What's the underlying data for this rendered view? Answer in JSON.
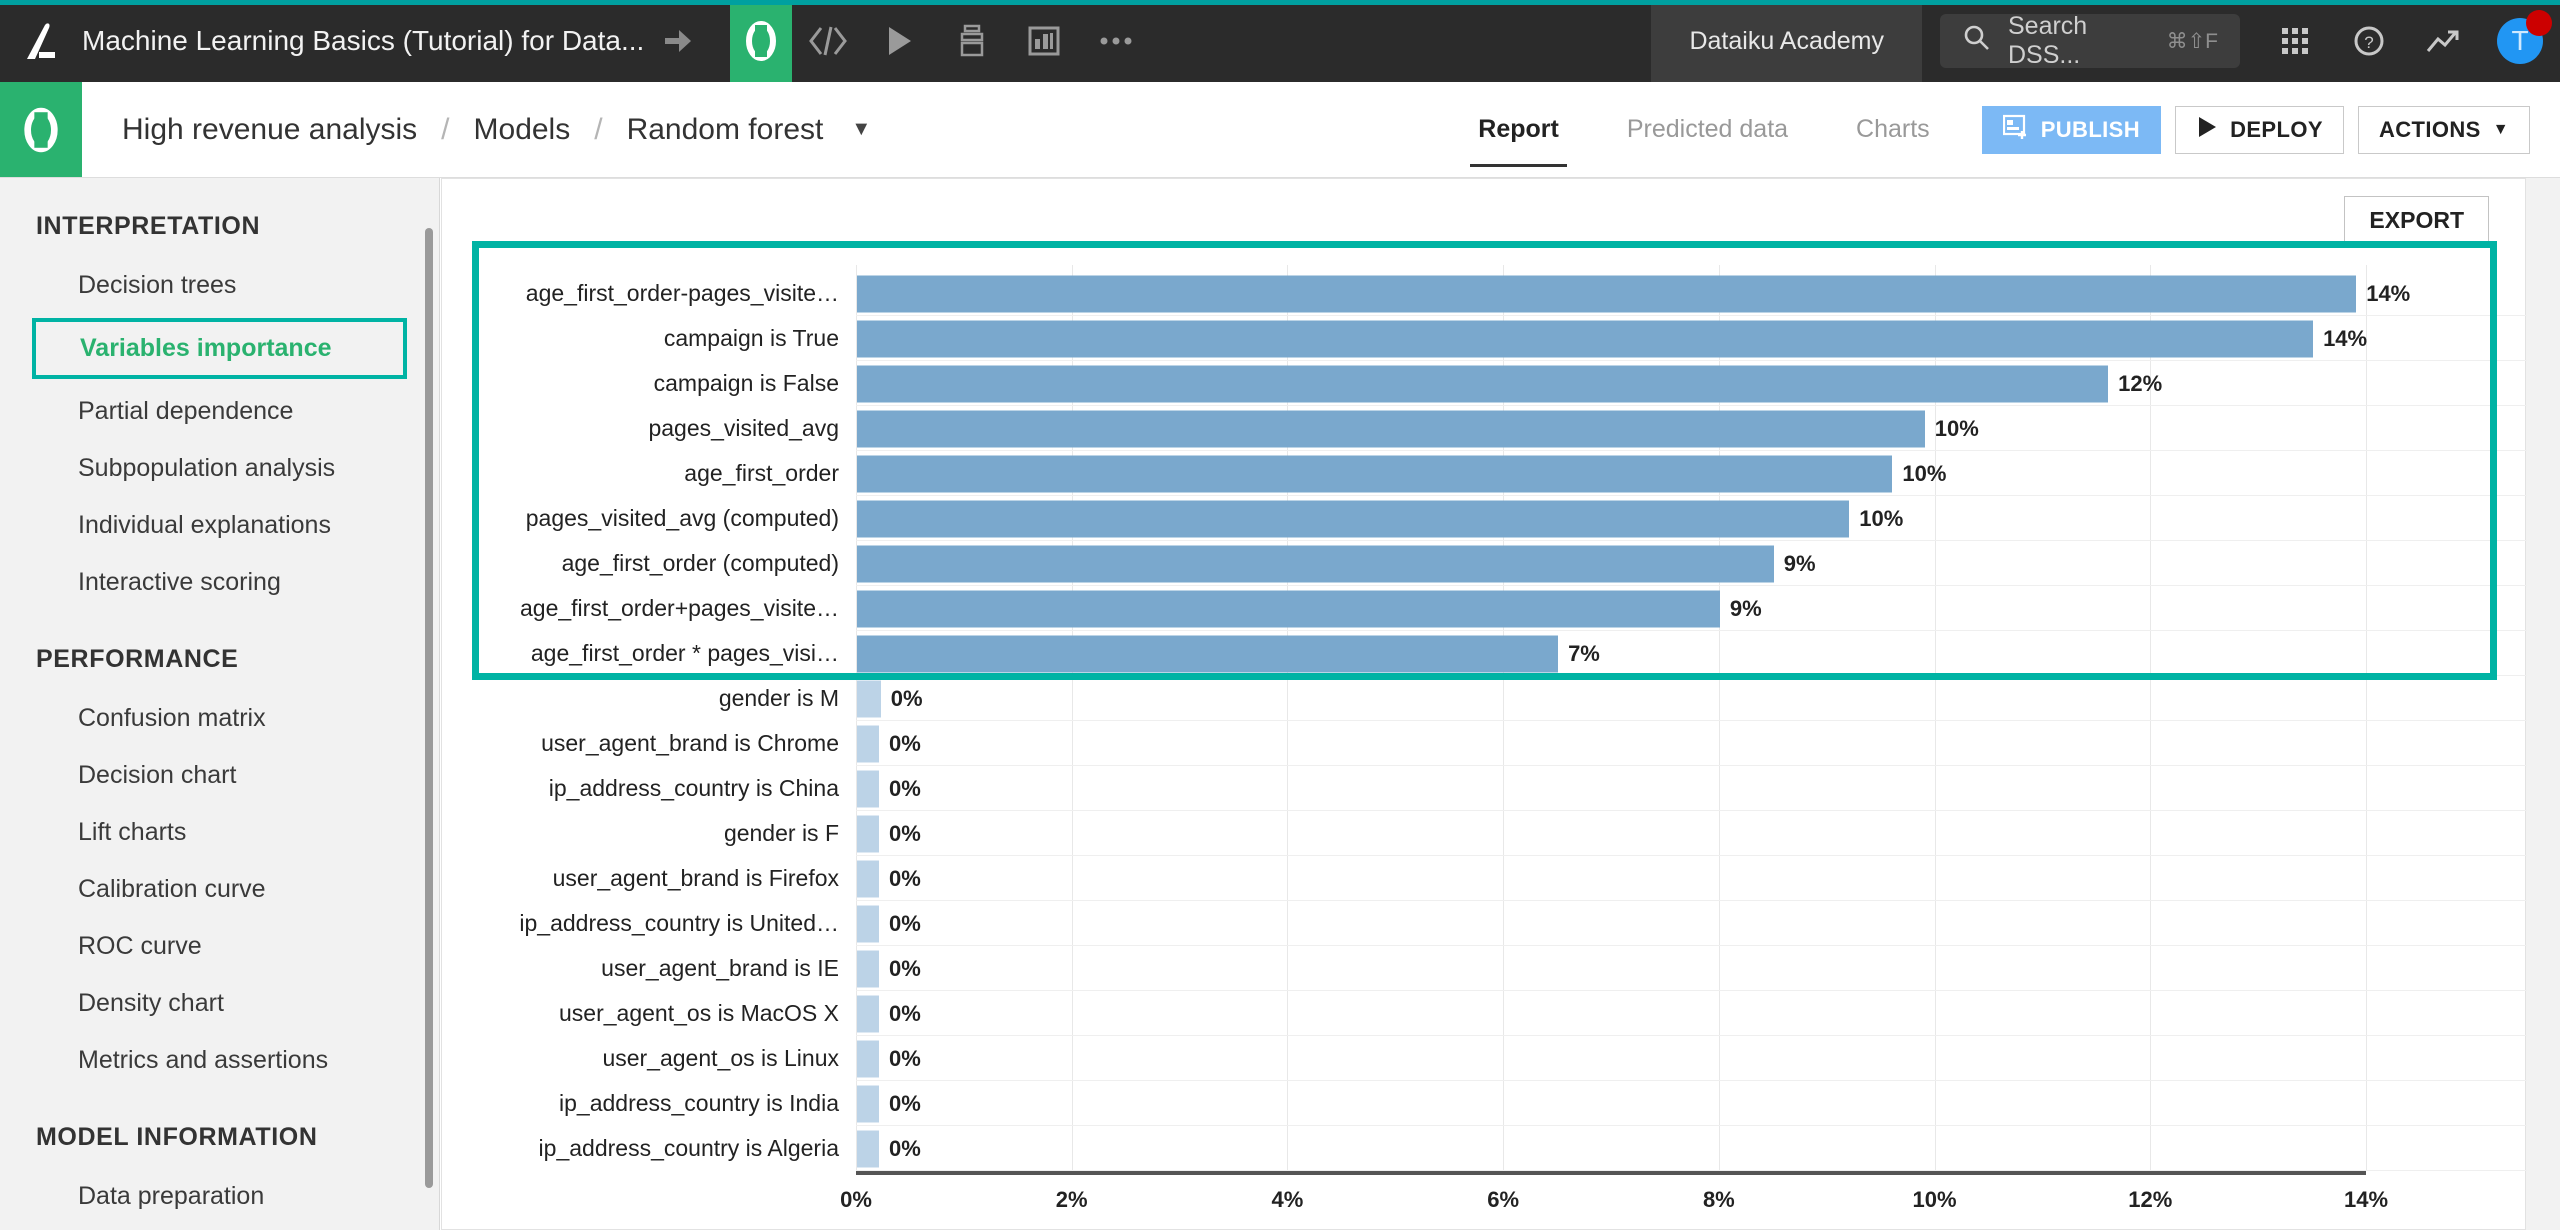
{
  "topbar": {
    "project_title": "Machine Learning Basics (Tutorial) for Data...",
    "logo_icon": "dataiku-flame-icon",
    "flow_icon": "flow-branch-icon",
    "lab_icon": "dataiku-lab-icon",
    "code_icon": "code-brackets-icon",
    "run_icon": "play-triangle-icon",
    "jobs_icon": "jobs-stack-icon",
    "dashboard_icon": "dashboard-panel-icon",
    "more_icon": "ellipsis-icon",
    "academy_label": "Dataiku Academy",
    "search_placeholder": "Search DSS...",
    "search_icon": "search-icon",
    "search_shortcut": "⌘⇧F",
    "apps_icon": "apps-grid-icon",
    "help_icon": "help-circle-icon",
    "trend_icon": "trend-arrow-icon",
    "avatar_initial": "T",
    "avatar_name": "avatar",
    "notification_badge": ""
  },
  "subnav": {
    "logo_icon": "dataiku-project-icon",
    "breadcrumb": [
      "High revenue analysis",
      "Models",
      "Random forest"
    ],
    "breadcrumb_separator": "/",
    "breadcrumb_caret": "▼",
    "tabs": [
      {
        "label": "Report",
        "active": true
      },
      {
        "label": "Predicted data",
        "active": false
      },
      {
        "label": "Charts",
        "active": false
      }
    ],
    "publish_label": "PUBLISH",
    "publish_icon": "publish-dashboard-icon",
    "deploy_label": "DEPLOY",
    "deploy_icon": "play-triangle-icon",
    "actions_label": "ACTIONS",
    "actions_caret": "▼"
  },
  "sidebar": {
    "sections": [
      {
        "title": "INTERPRETATION",
        "items": [
          {
            "label": "Decision trees",
            "selected": false
          },
          {
            "label": "Variables importance",
            "selected": true
          },
          {
            "label": "Partial dependence",
            "selected": false
          },
          {
            "label": "Subpopulation analysis",
            "selected": false
          },
          {
            "label": "Individual explanations",
            "selected": false
          },
          {
            "label": "Interactive scoring",
            "selected": false
          }
        ]
      },
      {
        "title": "PERFORMANCE",
        "items": [
          {
            "label": "Confusion matrix",
            "selected": false
          },
          {
            "label": "Decision chart",
            "selected": false
          },
          {
            "label": "Lift charts",
            "selected": false
          },
          {
            "label": "Calibration curve",
            "selected": false
          },
          {
            "label": "ROC curve",
            "selected": false
          },
          {
            "label": "Density chart",
            "selected": false
          },
          {
            "label": "Metrics and assertions",
            "selected": false
          }
        ]
      },
      {
        "title": "MODEL INFORMATION",
        "items": [
          {
            "label": "Data preparation",
            "selected": false
          }
        ]
      }
    ]
  },
  "main": {
    "export_label": "EXPORT"
  },
  "colors": {
    "accent_teal": "#00b3a4",
    "brand_green": "#2ab26f",
    "bar_primary": "#7aa8cd",
    "bar_small": "#bcd3e7",
    "publish_blue": "#7cb9f5"
  },
  "chart_data": {
    "type": "bar",
    "orientation": "horizontal",
    "title": "",
    "xlabel": "",
    "ylabel": "",
    "xlim": [
      0,
      14
    ],
    "grid": true,
    "legend": "none",
    "xticks": [
      "0%",
      "2%",
      "4%",
      "6%",
      "8%",
      "10%",
      "12%",
      "14%"
    ],
    "xtick_values": [
      0,
      2,
      4,
      6,
      8,
      10,
      12,
      14
    ],
    "categories": [
      "age_first_order-pages_visite…",
      "campaign is True",
      "campaign is False",
      "pages_visited_avg",
      "age_first_order",
      "pages_visited_avg (computed)",
      "age_first_order (computed)",
      "age_first_order+pages_visite…",
      "age_first_order * pages_visi…",
      "gender is M",
      "user_agent_brand is Chrome",
      "ip_address_country is China",
      "gender is F",
      "user_agent_brand is Firefox",
      "ip_address_country is United…",
      "user_agent_brand is IE",
      "user_agent_os is MacOS X",
      "user_agent_os is Linux",
      "ip_address_country is India",
      "ip_address_country is Algeria"
    ],
    "values": [
      13.9,
      13.5,
      11.6,
      9.9,
      9.6,
      9.2,
      8.5,
      8.0,
      6.5,
      0.22,
      0.2,
      0.2,
      0.19,
      0.18,
      0.18,
      0.17,
      0.17,
      0.16,
      0.15,
      0.14
    ],
    "labels": [
      "14%",
      "14%",
      "12%",
      "10%",
      "10%",
      "10%",
      "9%",
      "9%",
      "7%",
      "0%",
      "0%",
      "0%",
      "0%",
      "0%",
      "0%",
      "0%",
      "0%",
      "0%",
      "0%",
      "0%"
    ]
  }
}
